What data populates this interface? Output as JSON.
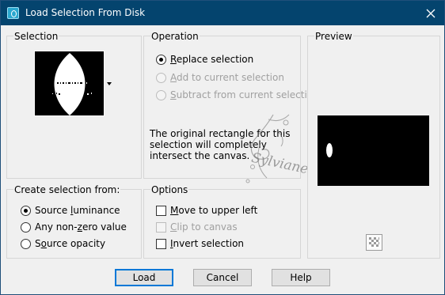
{
  "window": {
    "title": "Load Selection From Disk",
    "title_icon": "selection-icon",
    "close_icon": "close-icon"
  },
  "selection_group": {
    "title": "Selection",
    "dropdown_icon": "chevron-down-icon"
  },
  "operation_group": {
    "title": "Operation",
    "options": [
      {
        "label": "Replace selection",
        "checked": true,
        "enabled": true
      },
      {
        "label": "Add to current selection",
        "checked": false,
        "enabled": false
      },
      {
        "label": "Subtract from current selection",
        "checked": false,
        "enabled": false
      }
    ],
    "info_text": "The original rectangle for this selection will completely intersect the canvas."
  },
  "preview_group": {
    "title": "Preview",
    "background_toggle_icon": "checkerboard-icon"
  },
  "create_group": {
    "title": "Create selection from:",
    "options": [
      {
        "label": "Source luminance",
        "checked": true
      },
      {
        "label": "Any non-zero value",
        "checked": false
      },
      {
        "label": "Source opacity",
        "checked": false
      }
    ]
  },
  "options_group": {
    "title": "Options",
    "items": [
      {
        "label": "Move to upper left",
        "checked": false,
        "enabled": true
      },
      {
        "label": "Clip to canvas",
        "checked": false,
        "enabled": false
      },
      {
        "label": "Invert selection",
        "checked": false,
        "enabled": true
      }
    ]
  },
  "watermark": {
    "text": "Sylviane"
  },
  "buttons": {
    "load": "Load",
    "cancel": "Cancel",
    "help": "Help"
  },
  "colors": {
    "title_bar": "#04446e",
    "default_button_border": "#0078d7"
  }
}
